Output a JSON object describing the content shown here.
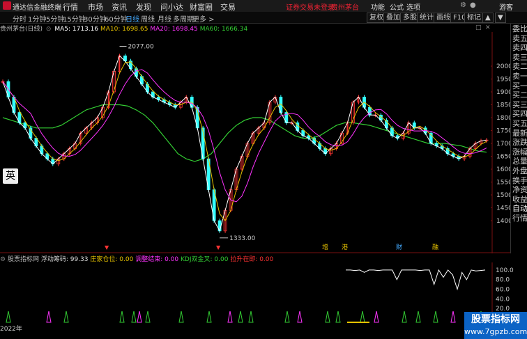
{
  "app": {
    "title": "通达信金融终端"
  },
  "menu": [
    "行情",
    "市场",
    "资讯",
    "发现",
    "问小达",
    "财富圈",
    "交易"
  ],
  "warning": "证券交易未登录",
  "stock_name_top": "贵州茅台",
  "right_menu": [
    "功能",
    "公式",
    "选项",
    "游客"
  ],
  "periods": [
    "分时",
    "1分钟",
    "5分钟",
    "15分钟",
    "30分钟",
    "60分钟",
    "日线",
    "周线",
    "月线",
    "多周期",
    "更多 >"
  ],
  "active_period": "日线",
  "toolbar": [
    "复权",
    "叠加",
    "多股",
    "统计",
    "画线",
    "F10",
    "标记"
  ],
  "legend": {
    "name": "贵州茅台(日线)",
    "ma5": "MA5: 1713.16",
    "ma10": "MA10: 1698.65",
    "ma20": "MA20: 1698.45",
    "ma60": "MA60: 1666.34"
  },
  "right_panel_items": [
    "委比",
    "卖五",
    "卖四",
    "卖三",
    "卖二",
    "卖一",
    "买一",
    "买二",
    "买三",
    "买四",
    "买五",
    "最新",
    "涨跌",
    "涨幅",
    "总量",
    "外盘",
    "换手",
    "净资",
    "收益",
    "自动",
    "行情"
  ],
  "price_axis": [
    "2000",
    "1950",
    "1900",
    "1850",
    "1800",
    "1750",
    "1700",
    "1650",
    "1600",
    "1550",
    "1500",
    "1450",
    "1400"
  ],
  "annotations": {
    "high": "2077.00",
    "low": "1333.00"
  },
  "markers": [
    "增",
    "港",
    "财",
    "融"
  ],
  "ying_button": "英",
  "sub_legend": {
    "name": "股票指标网",
    "float": "浮动筹码: 99.33",
    "a1": "庄家仓位: 0.00",
    "a2": "调整结束: 0.00",
    "a3": "KDJ双金叉: 0.00",
    "a4": "拉升在即: 0.00"
  },
  "sub_axis": [
    "100.0",
    "80.0",
    "60.0",
    "40.0",
    "20.0"
  ],
  "footer_year": "2022年",
  "watermark": {
    "line1": "股票指标网",
    "line2": "www.7gpzb.com"
  },
  "colors": {
    "ma5": "#ffffff",
    "ma10": "#e6c200",
    "ma20": "#ff33ff",
    "ma60": "#33cc33",
    "up": "#ff3333",
    "down": "#33ffff"
  },
  "chart_data": {
    "type": "line",
    "title": "贵州茅台(日线)",
    "ylim": [
      1333,
      2077
    ],
    "close": [
      1940,
      1880,
      1820,
      1780,
      1760,
      1720,
      1690,
      1660,
      1640,
      1620,
      1640,
      1660,
      1680,
      1700,
      1740,
      1760,
      1780,
      1800,
      1840,
      1900,
      1980,
      2040,
      2020,
      1990,
      1960,
      1930,
      1900,
      1880,
      1870,
      1860,
      1850,
      1840,
      1860,
      1880,
      1840,
      1760,
      1640,
      1520,
      1400,
      1360,
      1440,
      1520,
      1600,
      1650,
      1700,
      1740,
      1760,
      1780,
      1860,
      1880,
      1820,
      1780,
      1780,
      1750,
      1730,
      1720,
      1700,
      1680,
      1660,
      1680,
      1700,
      1740,
      1780,
      1860,
      1880,
      1840,
      1810,
      1810,
      1790,
      1760,
      1730,
      1720,
      1740,
      1780,
      1760,
      1760,
      1740,
      1700,
      1690,
      1680,
      1660,
      1650,
      1640,
      1650,
      1680,
      1700,
      1710,
      1713
    ],
    "ma60": [
      1800,
      1790,
      1780,
      1770,
      1760,
      1760,
      1760,
      1770,
      1790,
      1810,
      1830,
      1840,
      1850,
      1850,
      1850,
      1845,
      1830,
      1810,
      1780,
      1740,
      1700,
      1660,
      1640,
      1630,
      1640,
      1660,
      1700,
      1740,
      1770,
      1790,
      1800,
      1800,
      1790,
      1770,
      1750,
      1730,
      1720,
      1720,
      1730,
      1750,
      1770,
      1780,
      1780,
      1775,
      1770,
      1760,
      1750,
      1740,
      1730,
      1720,
      1710,
      1700,
      1700,
      1700,
      1695,
      1690,
      1680,
      1670,
      1666
    ],
    "sub_series": [
      100,
      100,
      99,
      100,
      95,
      100,
      100,
      99,
      100,
      100,
      100,
      80,
      100,
      100,
      100,
      100,
      99,
      100,
      100,
      70,
      100,
      85,
      100,
      90,
      60,
      95,
      80,
      100,
      98,
      99,
      100
    ]
  }
}
